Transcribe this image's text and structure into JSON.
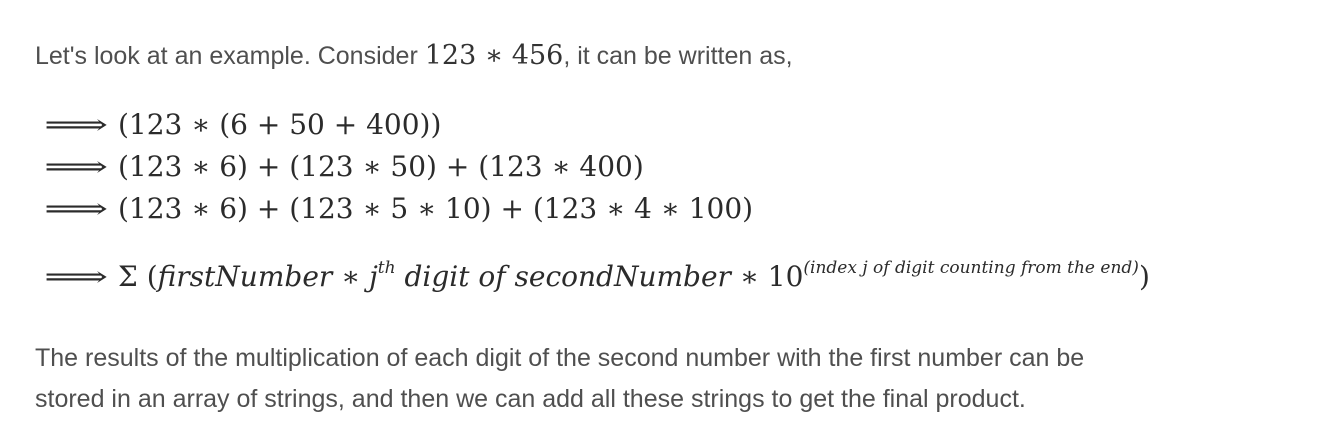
{
  "intro": {
    "before": "Let's look at an example. Consider ",
    "math": "123 ∗ 456",
    "after": ", it can be written as,"
  },
  "equations": {
    "arrow": "⟹",
    "line1": "(123 ∗ (6 + 50 + 400))",
    "line2": "(123 ∗ 6) + (123 ∗ 50) + (123 ∗ 400)",
    "line3": "(123 ∗ 6) + (123 ∗ 5 ∗ 10) + (123 ∗ 4 ∗ 100)",
    "line4": {
      "sigma": "Σ (",
      "first": "firstNumber ∗ j",
      "th": "th",
      "middle": " digit of secondNumber",
      "times_ten": " ∗ 10",
      "exponent": "(index j of digit counting from the end)",
      "close": ")"
    }
  },
  "results": {
    "line1": "The results of the multiplication of each digit of the second number with the first number can be",
    "line2": "stored in an array of strings, and then we can add all these strings to get the final product."
  }
}
